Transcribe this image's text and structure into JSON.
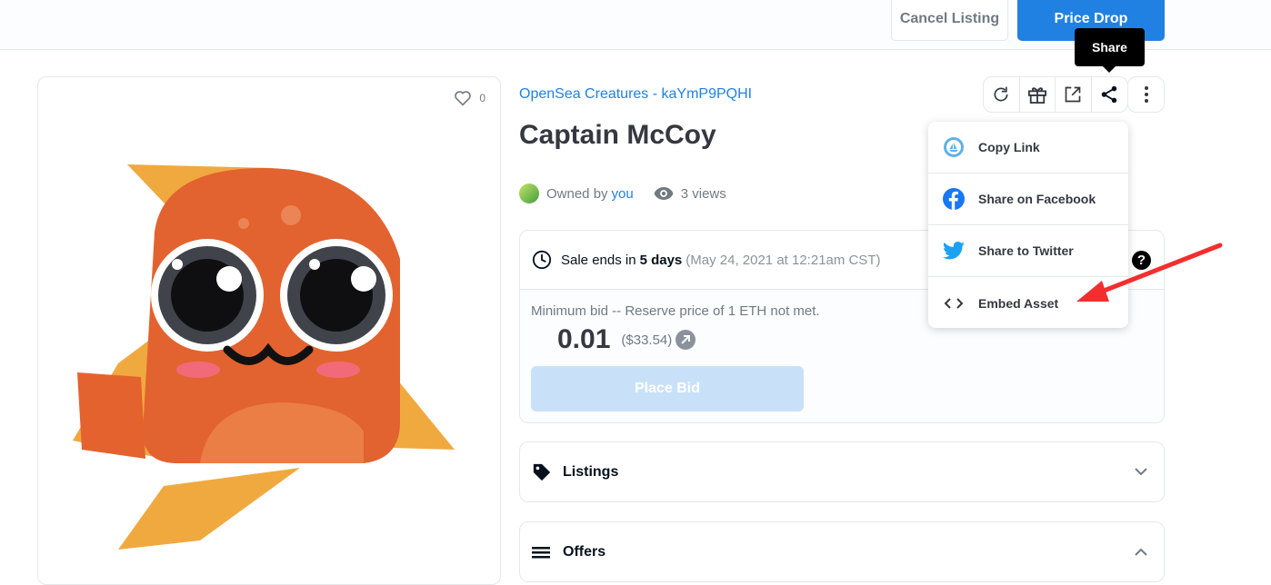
{
  "topbar": {
    "cancel_label": "Cancel Listing",
    "price_drop_label": "Price Drop"
  },
  "image_card": {
    "favorites_count": "0"
  },
  "asset": {
    "collection": "OpenSea Creatures - kaYmP9PQHI",
    "title": "Captain McCoy",
    "owned_by_label": "Owned by",
    "owner": "you",
    "views": "3 views"
  },
  "sale": {
    "prefix": "Sale ends in",
    "duration": "5 days",
    "end_time": "(May 24, 2021 at 12:21am CST)",
    "min_bid_label": "Minimum bid -- Reserve price of 1 ETH not met.",
    "price": "0.01",
    "usd": "($33.54)",
    "place_bid_label": "Place Bid"
  },
  "panels": {
    "listings": "Listings",
    "offers": "Offers"
  },
  "toolbar": {
    "tooltip": "Share",
    "icons": [
      "refresh-icon",
      "gift-icon",
      "external-link-icon",
      "share-icon",
      "more-vertical-icon"
    ]
  },
  "share_menu": {
    "items": [
      {
        "label": "Copy Link",
        "icon": "opensea-logo-icon"
      },
      {
        "label": "Share on Facebook",
        "icon": "facebook-icon"
      },
      {
        "label": "Share to Twitter",
        "icon": "twitter-icon"
      },
      {
        "label": "Embed Asset",
        "icon": "code-icon"
      }
    ]
  },
  "help_glyph": "?",
  "colors": {
    "primary": "#2081e2",
    "fish": "#e2632f",
    "fin": "#f0a93f",
    "annotation_arrow": "#f22e2e"
  }
}
